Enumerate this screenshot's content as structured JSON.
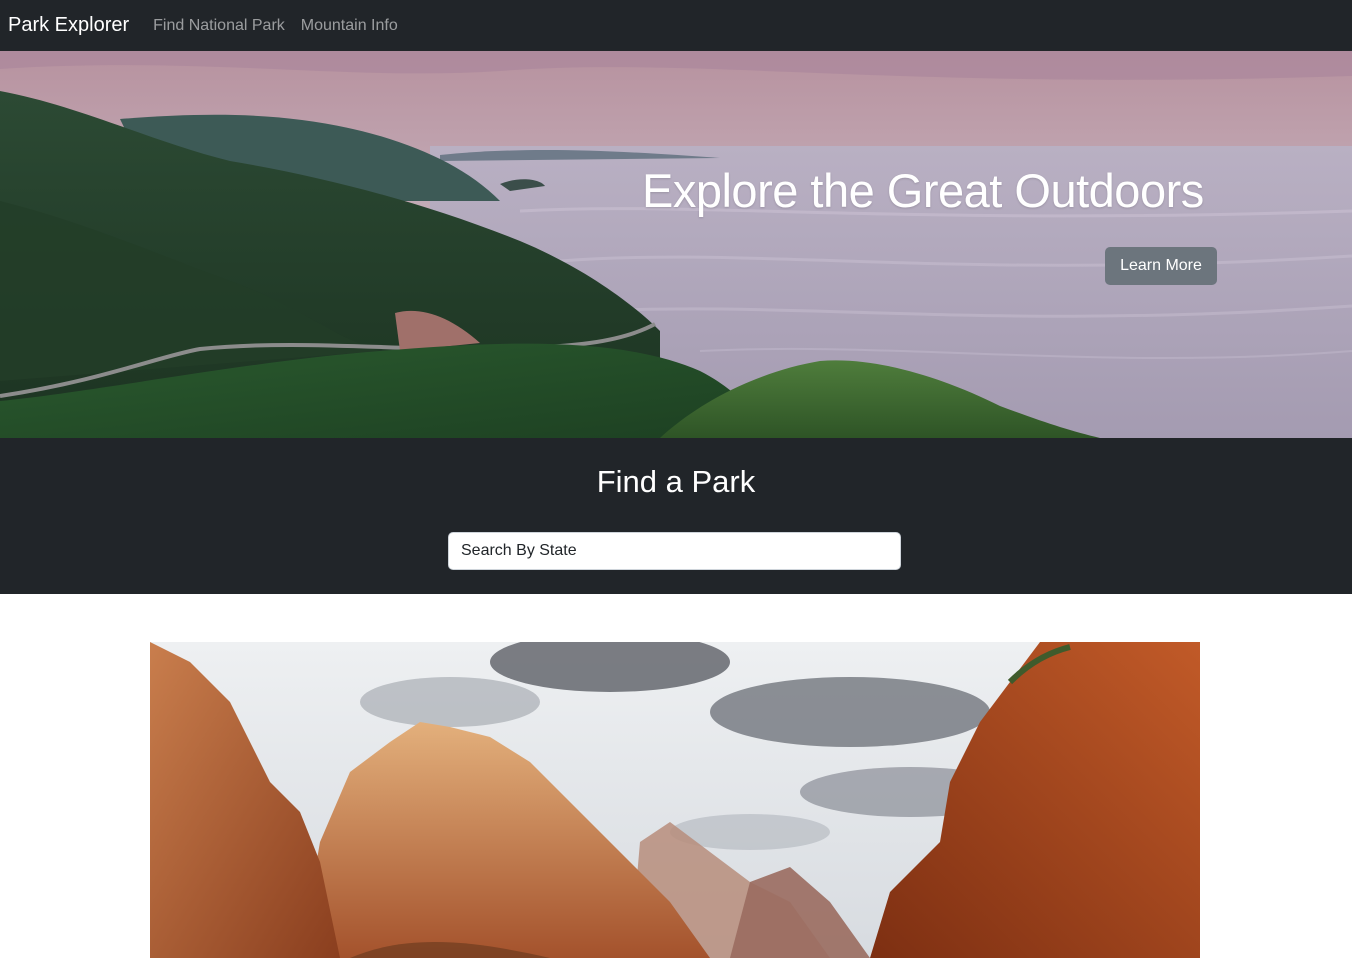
{
  "navbar": {
    "brand": "Park Explorer",
    "links": [
      "Find National Park",
      "Mountain Info"
    ],
    "background": "#212529"
  },
  "hero": {
    "title": "Explore the Great Outdoors",
    "button_label": "Learn More",
    "button_color": "#6c757d"
  },
  "find_park": {
    "title": "Find a Park",
    "search_placeholder": "Search By State",
    "background": "#212529"
  }
}
